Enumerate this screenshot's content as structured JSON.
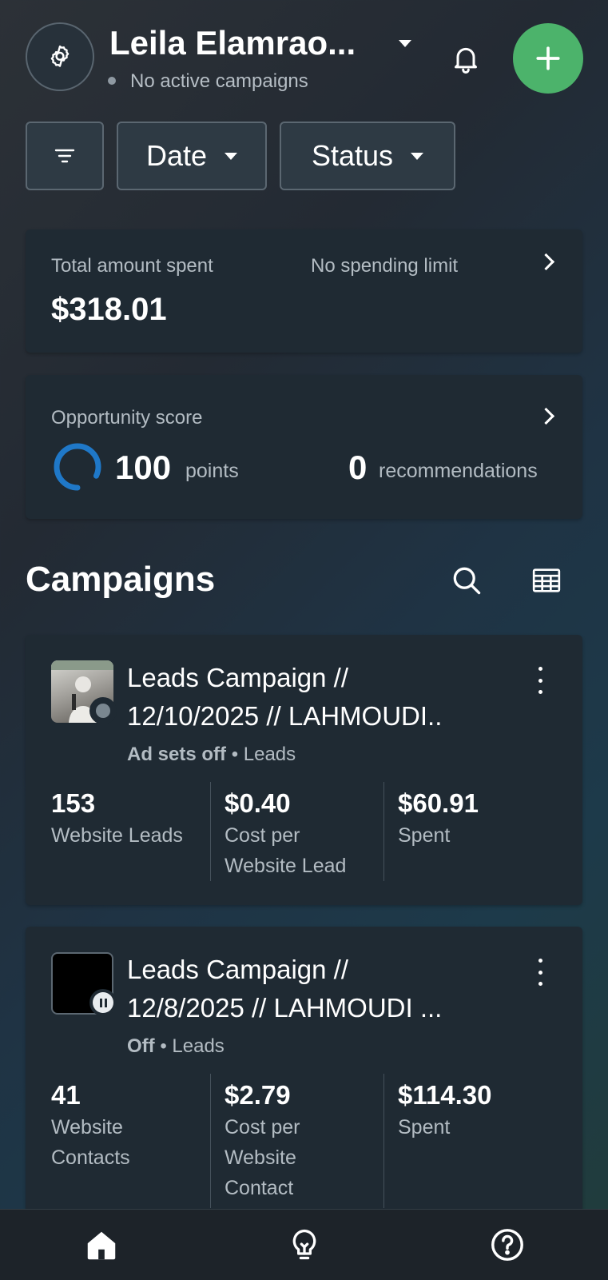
{
  "header": {
    "account_name": "Leila Elamrao...",
    "status_text": "No active campaigns"
  },
  "filters": {
    "date_label": "Date",
    "status_label": "Status"
  },
  "spend_card": {
    "label": "Total amount spent",
    "amount": "$318.01",
    "limit_text": "No spending limit"
  },
  "opportunity_card": {
    "label": "Opportunity score",
    "score_value": "100",
    "score_unit": "points",
    "score_fraction": 1.0,
    "recommendations_value": "0",
    "recommendations_unit": "recommendations"
  },
  "campaigns_section": {
    "title": "Campaigns"
  },
  "campaigns": [
    {
      "title_line1": "Leads Campaign //",
      "title_line2": "12/10/2025 // LAHMOUDI..",
      "status": "Ad sets off",
      "objective": "Leads",
      "metrics": [
        {
          "value": "153",
          "label": "Website Leads"
        },
        {
          "value": "$0.40",
          "label": "Cost per Website Lead"
        },
        {
          "value": "$60.91",
          "label": "Spent"
        }
      ]
    },
    {
      "title_line1": "Leads Campaign //",
      "title_line2": "12/8/2025 // LAHMOUDI ...",
      "status": "Off",
      "objective": "Leads",
      "metrics": [
        {
          "value": "41",
          "label": "Website Contacts"
        },
        {
          "value": "$2.79",
          "label": "Cost per Website Contact"
        },
        {
          "value": "$114.30",
          "label": "Spent"
        }
      ]
    }
  ],
  "icons": {
    "settings": "gear-icon",
    "bell": "bell-icon",
    "add": "plus-icon",
    "filter": "filter-lines-icon",
    "search": "search-icon",
    "table": "table-icon",
    "home": "home-icon",
    "ideas": "lightbulb-icon",
    "help": "help-icon"
  },
  "colors": {
    "accent_green": "#4cb36b",
    "score_ring_blue": "#1f78c8",
    "card_bg": "#1f2a33"
  }
}
